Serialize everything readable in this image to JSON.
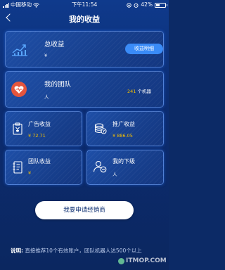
{
  "status_bar": {
    "carrier": "中国移动",
    "network": "",
    "time": "下午11:54",
    "battery": "42%",
    "battery_level": 0.42
  },
  "nav": {
    "title": "我的收益"
  },
  "total_income": {
    "label": "总收益",
    "currency": "¥",
    "amount": "",
    "detail_button": "收益明细"
  },
  "my_team": {
    "label": "我的团队",
    "count": "",
    "unit": "人",
    "machines": "241",
    "machines_unit": "个机器"
  },
  "grid": [
    {
      "label": "广告收益",
      "value": "¥ 72.71",
      "extra": "",
      "icon": "clipboard-yen-icon"
    },
    {
      "label": "推广收益",
      "value": "¥ 886.05",
      "extra": "",
      "icon": "coins-stack-icon"
    },
    {
      "label": "团队收益",
      "value": "¥",
      "extra": "",
      "icon": "notebook-icon"
    },
    {
      "label": "我的下级",
      "value": "",
      "extra": "人",
      "icon": "user-minus-icon"
    }
  ],
  "apply_button": "我要申请经销商",
  "note": {
    "prefix": "说明:",
    "text": "直接推荐10个有效账户，团队机器人达500个以上"
  },
  "watermark": "ITMOP.COM",
  "colors": {
    "background": "#0c2a66",
    "card": "#1e4fa8",
    "accent_button": "#3a8bf7",
    "highlight_red": "#ff2b2b",
    "highlight_gold": "#f5c000"
  }
}
